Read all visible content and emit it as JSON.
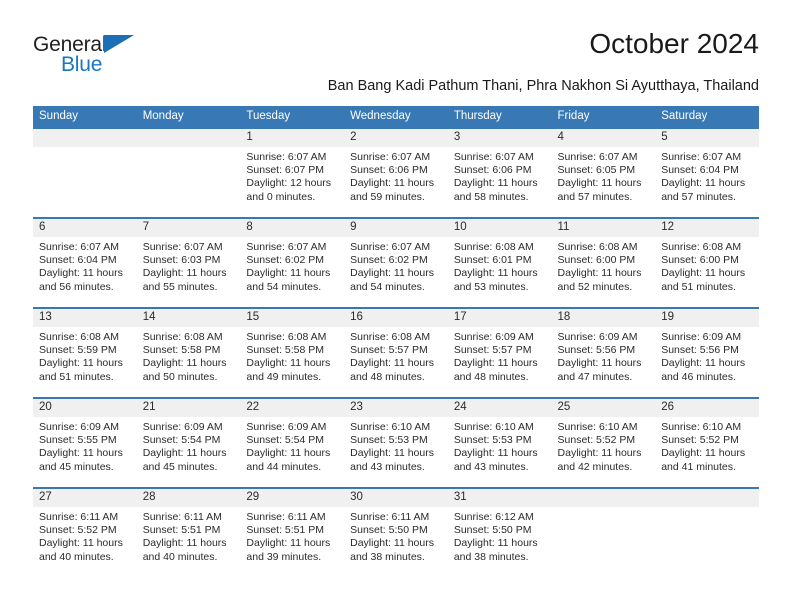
{
  "brand": {
    "name_part1": "General",
    "name_part2": "Blue",
    "logo_icon": "triangle-icon",
    "color_dark": "#231f20",
    "color_blue": "#1a76c4"
  },
  "header": {
    "month_title": "October 2024",
    "location": "Ban Bang Kadi Pathum Thani, Phra Nakhon Si Ayutthaya, Thailand"
  },
  "theme": {
    "header_bg": "#3878b4",
    "header_text": "#ffffff",
    "daynum_band_bg": "#f0f0f0",
    "cell_bg": "#ffffff",
    "text": "#2b2b2b"
  },
  "weekday_headers": [
    "Sunday",
    "Monday",
    "Tuesday",
    "Wednesday",
    "Thursday",
    "Friday",
    "Saturday"
  ],
  "labels": {
    "sunrise_prefix": "Sunrise:",
    "sunset_prefix": "Sunset:",
    "daylight_prefix": "Daylight:"
  },
  "weeks": [
    [
      {
        "day": "",
        "empty": true
      },
      {
        "day": "",
        "empty": true
      },
      {
        "day": "1",
        "sunrise": "Sunrise: 6:07 AM",
        "sunset": "Sunset: 6:07 PM",
        "daylight": "Daylight: 12 hours and 0 minutes."
      },
      {
        "day": "2",
        "sunrise": "Sunrise: 6:07 AM",
        "sunset": "Sunset: 6:06 PM",
        "daylight": "Daylight: 11 hours and 59 minutes."
      },
      {
        "day": "3",
        "sunrise": "Sunrise: 6:07 AM",
        "sunset": "Sunset: 6:06 PM",
        "daylight": "Daylight: 11 hours and 58 minutes."
      },
      {
        "day": "4",
        "sunrise": "Sunrise: 6:07 AM",
        "sunset": "Sunset: 6:05 PM",
        "daylight": "Daylight: 11 hours and 57 minutes."
      },
      {
        "day": "5",
        "sunrise": "Sunrise: 6:07 AM",
        "sunset": "Sunset: 6:04 PM",
        "daylight": "Daylight: 11 hours and 57 minutes."
      }
    ],
    [
      {
        "day": "6",
        "sunrise": "Sunrise: 6:07 AM",
        "sunset": "Sunset: 6:04 PM",
        "daylight": "Daylight: 11 hours and 56 minutes."
      },
      {
        "day": "7",
        "sunrise": "Sunrise: 6:07 AM",
        "sunset": "Sunset: 6:03 PM",
        "daylight": "Daylight: 11 hours and 55 minutes."
      },
      {
        "day": "8",
        "sunrise": "Sunrise: 6:07 AM",
        "sunset": "Sunset: 6:02 PM",
        "daylight": "Daylight: 11 hours and 54 minutes."
      },
      {
        "day": "9",
        "sunrise": "Sunrise: 6:07 AM",
        "sunset": "Sunset: 6:02 PM",
        "daylight": "Daylight: 11 hours and 54 minutes."
      },
      {
        "day": "10",
        "sunrise": "Sunrise: 6:08 AM",
        "sunset": "Sunset: 6:01 PM",
        "daylight": "Daylight: 11 hours and 53 minutes."
      },
      {
        "day": "11",
        "sunrise": "Sunrise: 6:08 AM",
        "sunset": "Sunset: 6:00 PM",
        "daylight": "Daylight: 11 hours and 52 minutes."
      },
      {
        "day": "12",
        "sunrise": "Sunrise: 6:08 AM",
        "sunset": "Sunset: 6:00 PM",
        "daylight": "Daylight: 11 hours and 51 minutes."
      }
    ],
    [
      {
        "day": "13",
        "sunrise": "Sunrise: 6:08 AM",
        "sunset": "Sunset: 5:59 PM",
        "daylight": "Daylight: 11 hours and 51 minutes."
      },
      {
        "day": "14",
        "sunrise": "Sunrise: 6:08 AM",
        "sunset": "Sunset: 5:58 PM",
        "daylight": "Daylight: 11 hours and 50 minutes."
      },
      {
        "day": "15",
        "sunrise": "Sunrise: 6:08 AM",
        "sunset": "Sunset: 5:58 PM",
        "daylight": "Daylight: 11 hours and 49 minutes."
      },
      {
        "day": "16",
        "sunrise": "Sunrise: 6:08 AM",
        "sunset": "Sunset: 5:57 PM",
        "daylight": "Daylight: 11 hours and 48 minutes."
      },
      {
        "day": "17",
        "sunrise": "Sunrise: 6:09 AM",
        "sunset": "Sunset: 5:57 PM",
        "daylight": "Daylight: 11 hours and 48 minutes."
      },
      {
        "day": "18",
        "sunrise": "Sunrise: 6:09 AM",
        "sunset": "Sunset: 5:56 PM",
        "daylight": "Daylight: 11 hours and 47 minutes."
      },
      {
        "day": "19",
        "sunrise": "Sunrise: 6:09 AM",
        "sunset": "Sunset: 5:56 PM",
        "daylight": "Daylight: 11 hours and 46 minutes."
      }
    ],
    [
      {
        "day": "20",
        "sunrise": "Sunrise: 6:09 AM",
        "sunset": "Sunset: 5:55 PM",
        "daylight": "Daylight: 11 hours and 45 minutes."
      },
      {
        "day": "21",
        "sunrise": "Sunrise: 6:09 AM",
        "sunset": "Sunset: 5:54 PM",
        "daylight": "Daylight: 11 hours and 45 minutes."
      },
      {
        "day": "22",
        "sunrise": "Sunrise: 6:09 AM",
        "sunset": "Sunset: 5:54 PM",
        "daylight": "Daylight: 11 hours and 44 minutes."
      },
      {
        "day": "23",
        "sunrise": "Sunrise: 6:10 AM",
        "sunset": "Sunset: 5:53 PM",
        "daylight": "Daylight: 11 hours and 43 minutes."
      },
      {
        "day": "24",
        "sunrise": "Sunrise: 6:10 AM",
        "sunset": "Sunset: 5:53 PM",
        "daylight": "Daylight: 11 hours and 43 minutes."
      },
      {
        "day": "25",
        "sunrise": "Sunrise: 6:10 AM",
        "sunset": "Sunset: 5:52 PM",
        "daylight": "Daylight: 11 hours and 42 minutes."
      },
      {
        "day": "26",
        "sunrise": "Sunrise: 6:10 AM",
        "sunset": "Sunset: 5:52 PM",
        "daylight": "Daylight: 11 hours and 41 minutes."
      }
    ],
    [
      {
        "day": "27",
        "sunrise": "Sunrise: 6:11 AM",
        "sunset": "Sunset: 5:52 PM",
        "daylight": "Daylight: 11 hours and 40 minutes."
      },
      {
        "day": "28",
        "sunrise": "Sunrise: 6:11 AM",
        "sunset": "Sunset: 5:51 PM",
        "daylight": "Daylight: 11 hours and 40 minutes."
      },
      {
        "day": "29",
        "sunrise": "Sunrise: 6:11 AM",
        "sunset": "Sunset: 5:51 PM",
        "daylight": "Daylight: 11 hours and 39 minutes."
      },
      {
        "day": "30",
        "sunrise": "Sunrise: 6:11 AM",
        "sunset": "Sunset: 5:50 PM",
        "daylight": "Daylight: 11 hours and 38 minutes."
      },
      {
        "day": "31",
        "sunrise": "Sunrise: 6:12 AM",
        "sunset": "Sunset: 5:50 PM",
        "daylight": "Daylight: 11 hours and 38 minutes."
      },
      {
        "day": "",
        "empty": true
      },
      {
        "day": "",
        "empty": true
      }
    ]
  ]
}
